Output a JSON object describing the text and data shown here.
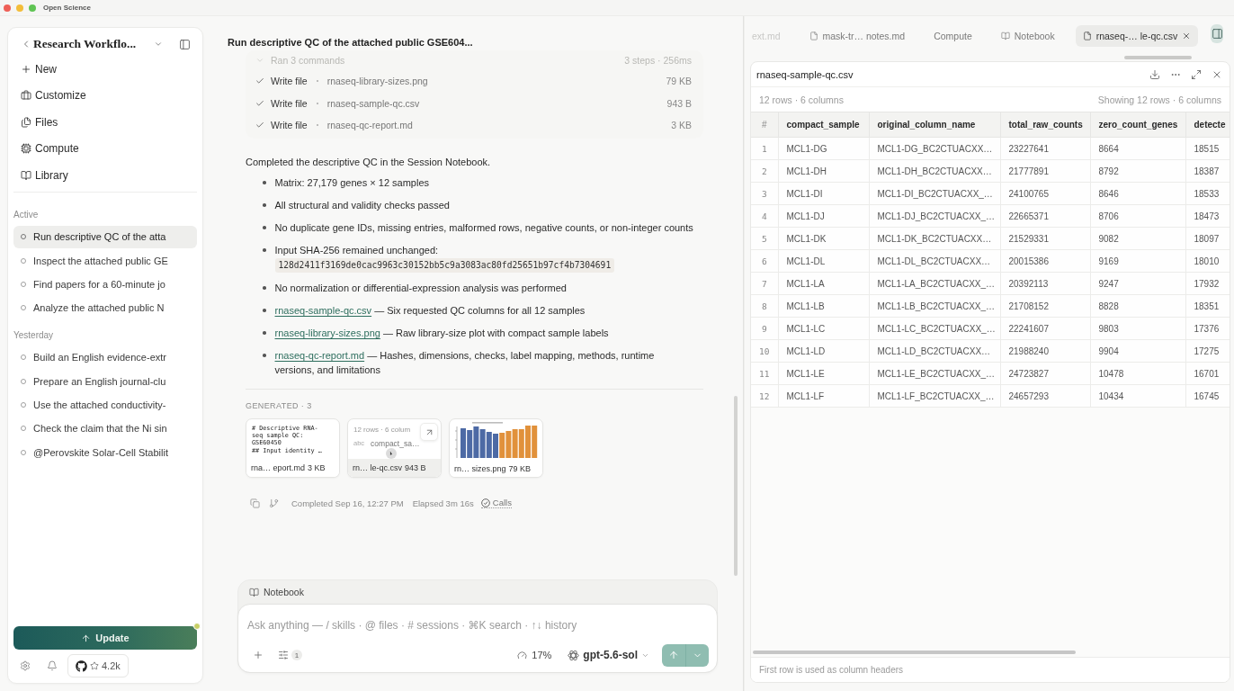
{
  "window": {
    "title": "Open Science"
  },
  "sidebar": {
    "project": "Research Workflo...",
    "nav": [
      {
        "kind": "new",
        "label": "New"
      },
      {
        "kind": "customize",
        "label": "Customize"
      },
      {
        "kind": "files",
        "label": "Files"
      },
      {
        "kind": "compute",
        "label": "Compute"
      },
      {
        "kind": "library",
        "label": "Library"
      }
    ],
    "sections": [
      {
        "heading": "Active",
        "sessions": [
          {
            "title": "Run descriptive QC of the atta",
            "selected": true
          },
          {
            "title": "Inspect the attached public GE",
            "selected": false
          },
          {
            "title": "Find papers for a 60-minute jo",
            "selected": false
          },
          {
            "title": "Analyze the attached public N",
            "selected": false
          }
        ]
      },
      {
        "heading": "Yesterday",
        "sessions": [
          {
            "title": "Build an English evidence-extr",
            "selected": false
          },
          {
            "title": "Prepare an English journal-clu",
            "selected": false
          },
          {
            "title": "Use the attached conductivity-",
            "selected": false
          },
          {
            "title": "Check the claim that the Ni sin",
            "selected": false
          },
          {
            "title": "@Perovskite Solar-Cell Stabilit",
            "selected": false
          }
        ]
      }
    ],
    "update": {
      "label": "Update",
      "dot": true
    },
    "github": {
      "count": "4.2k"
    }
  },
  "session": {
    "title": "Run descriptive QC of the attached public GSE604...",
    "tool_group": {
      "label": "Ran 3 commands",
      "meta": "3 steps · 256ms",
      "steps": [
        {
          "action": "Write file",
          "file": "rnaseq-library-sizes.png",
          "size": "79 KB",
          "done": true
        },
        {
          "action": "Write file",
          "file": "rnaseq-sample-qc.csv",
          "size": "943 B",
          "done": true
        },
        {
          "action": "Write file",
          "file": "rnaseq-qc-report.md",
          "size": "3 KB",
          "done": true
        }
      ]
    },
    "summary": "Completed the descriptive QC in the Session Notebook.",
    "bullets": [
      {
        "kind": "text",
        "text": "Matrix: 27,179 genes × 12 samples"
      },
      {
        "kind": "text",
        "text": "All structural and validity checks passed"
      },
      {
        "kind": "text",
        "text": "No duplicate gene IDs, missing entries, malformed rows, negative counts, or non-integer counts"
      },
      {
        "kind": "code",
        "text": "Input SHA-256 remained unchanged:",
        "code": "128d2411f3169de0cac9963c30152bb5c9a3083ac80fd25651b97cf4b7304691"
      },
      {
        "kind": "text",
        "text": "No normalization or differential-expression analysis was performed"
      },
      {
        "kind": "link",
        "link": "rnaseq-sample-qc.csv",
        "text": "— Six requested QC columns for all 12 samples"
      },
      {
        "kind": "link",
        "link": "rnaseq-library-sizes.png",
        "text": "— Raw library-size plot with compact sample labels"
      },
      {
        "kind": "link",
        "link": "rnaseq-qc-report.md",
        "text": "— Hashes, dimensions, checks, label mapping, methods, runtime versions, and limitations"
      }
    ],
    "generated": {
      "heading": "GENERATED · 3",
      "files": [
        {
          "kind": "markdown",
          "preview": [
            "# Descriptive RNA-",
            "seq sample QC:",
            "GSE60450",
            "## Input identity …"
          ],
          "name": "rna… eport.md",
          "size": "3 KB",
          "hovered": false
        },
        {
          "kind": "table",
          "summary": "12 rows · 6 colum",
          "type_label": "abc",
          "column": "compact_sa…",
          "name": "rn… le-qc.csv",
          "size": "943 B",
          "hovered": true
        },
        {
          "kind": "image",
          "name": "rn… sizes.png",
          "size": "79 KB",
          "hovered": false
        }
      ]
    },
    "meta": {
      "completed": "Completed Sep 16, 12:27 PM",
      "elapsed": "Elapsed 3m 16s",
      "calls": "Calls"
    }
  },
  "composer": {
    "context": "Notebook",
    "placeholder": "Ask anything — / skills · @ files · # sessions · ⌘K search · ↑↓ history",
    "settings_count": "1",
    "usage": "17%",
    "model": "gpt-5.6-sol"
  },
  "viewer": {
    "tabs": [
      {
        "kind": "clipped",
        "label": "ext.md",
        "selected": false
      },
      {
        "kind": "file",
        "label": "mask-tr… notes.md",
        "selected": false
      },
      {
        "kind": "plain",
        "label": "Compute",
        "selected": false
      },
      {
        "kind": "notebook",
        "label": "Notebook",
        "selected": false
      },
      {
        "kind": "file",
        "label": "rnaseq-… le-qc.csv",
        "selected": true
      }
    ],
    "title": "rnaseq-sample-qc.csv",
    "summary": "12 rows · 6 columns",
    "showing": "Showing 12 rows · 6 columns",
    "table": {
      "columns": [
        "#",
        "compact_sample",
        "original_column_name",
        "total_raw_counts",
        "zero_count_genes",
        "detecte"
      ],
      "rows": [
        [
          "1",
          "MCL1-DG",
          "MCL1-DG_BC2CTUACXX…",
          "23227641",
          "8664",
          "18515"
        ],
        [
          "2",
          "MCL1-DH",
          "MCL1-DH_BC2CTUACXX…",
          "21777891",
          "8792",
          "18387"
        ],
        [
          "3",
          "MCL1-DI",
          "MCL1-DI_BC2CTUACXX_…",
          "24100765",
          "8646",
          "18533"
        ],
        [
          "4",
          "MCL1-DJ",
          "MCL1-DJ_BC2CTUACXX_…",
          "22665371",
          "8706",
          "18473"
        ],
        [
          "5",
          "MCL1-DK",
          "MCL1-DK_BC2CTUACXX…",
          "21529331",
          "9082",
          "18097"
        ],
        [
          "6",
          "MCL1-DL",
          "MCL1-DL_BC2CTUACXX…",
          "20015386",
          "9169",
          "18010"
        ],
        [
          "7",
          "MCL1-LA",
          "MCL1-LA_BC2CTUACXX_…",
          "20392113",
          "9247",
          "17932"
        ],
        [
          "8",
          "MCL1-LB",
          "MCL1-LB_BC2CTUACXX_…",
          "21708152",
          "8828",
          "18351"
        ],
        [
          "9",
          "MCL1-LC",
          "MCL1-LC_BC2CTUACXX_…",
          "22241607",
          "9803",
          "17376"
        ],
        [
          "10",
          "MCL1-LD",
          "MCL1-LD_BC2CTUACXX…",
          "21988240",
          "9904",
          "17275"
        ],
        [
          "11",
          "MCL1-LE",
          "MCL1-LE_BC2CTUACXX_…",
          "24723827",
          "10478",
          "16701"
        ],
        [
          "12",
          "MCL1-LF",
          "MCL1-LF_BC2CTUACXX_…",
          "24657293",
          "10434",
          "16745"
        ]
      ]
    },
    "footer": "First row is used as column headers"
  }
}
